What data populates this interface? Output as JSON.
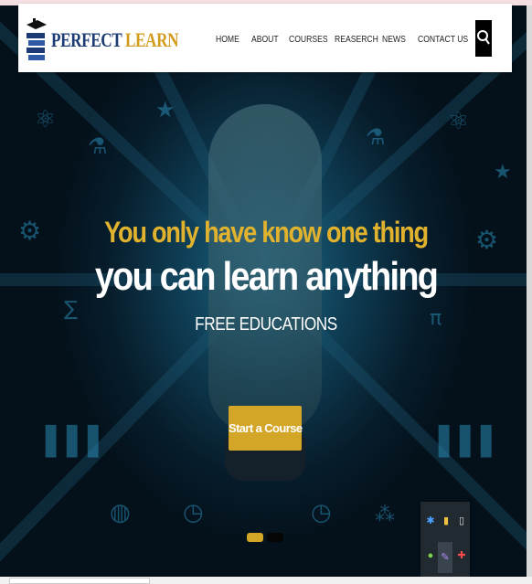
{
  "site": {
    "brand_part1": "PERFECT",
    "brand_part2": "LEARN"
  },
  "nav": {
    "items": [
      {
        "label": "HOME"
      },
      {
        "label": "ABOUT"
      },
      {
        "label": "COURSES"
      },
      {
        "label": "REASERCH"
      },
      {
        "label": "NEWS"
      },
      {
        "label": "CONTACT US"
      }
    ],
    "search_icon": "search-icon"
  },
  "hero": {
    "headline_small": "You only have know one thing",
    "headline_large": "you can learn anything",
    "subheading": "FREE EDUCATIONS",
    "cta_label": "Start a Course",
    "slides_total": 2,
    "slide_active": 1
  },
  "tray": {
    "icons": [
      "bluetooth-icon",
      "usb-drive-icon",
      "flashdrive-icon",
      "android-icon",
      "pen-icon",
      "antivirus-icon"
    ]
  },
  "colors": {
    "accent": "#d4a628",
    "brand_blue": "#1c3a73",
    "brand_gold": "#d39b1c",
    "hero_bg": "#0b2a3b"
  }
}
